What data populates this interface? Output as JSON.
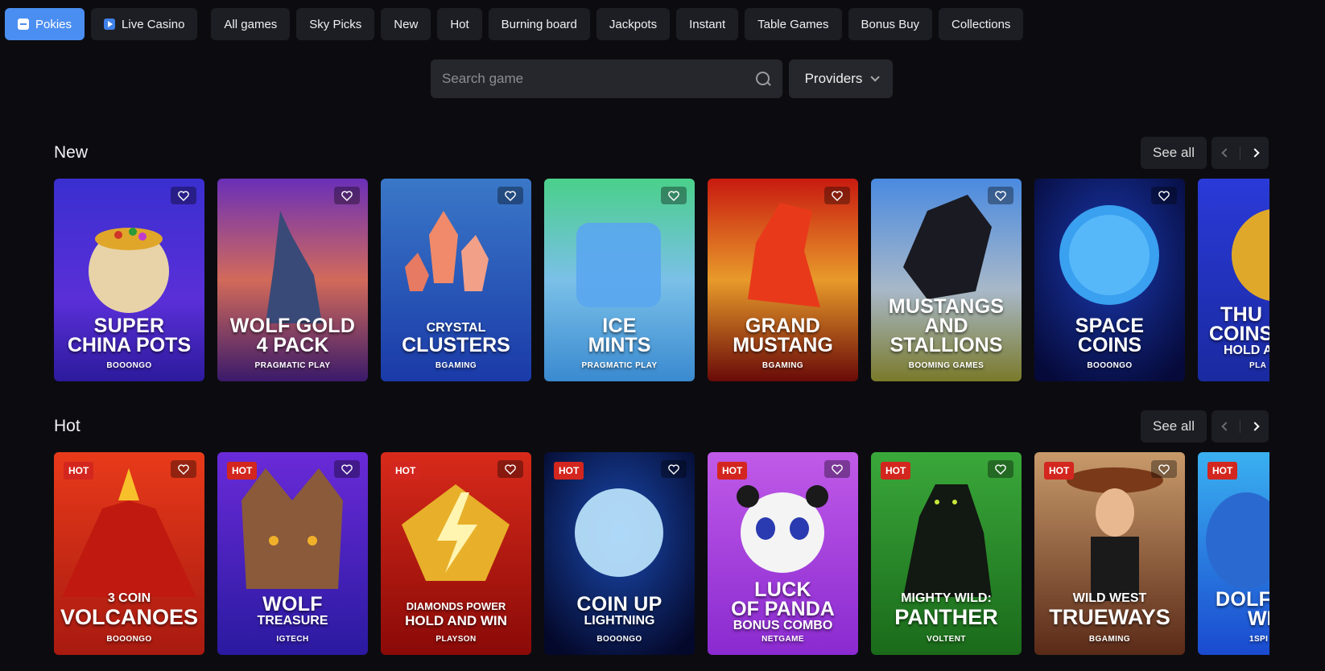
{
  "tabs": {
    "pokies": "Pokies",
    "live": "Live Casino",
    "categories": [
      "All games",
      "Sky Picks",
      "New",
      "Hot",
      "Burning board",
      "Jackpots",
      "Instant",
      "Table Games",
      "Bonus Buy",
      "Collections"
    ]
  },
  "search": {
    "placeholder": "Search game"
  },
  "providers": {
    "label": "Providers"
  },
  "sections": {
    "new": {
      "title": "New",
      "see_all": "See all",
      "games": [
        {
          "l1": "SUPER",
          "l2": "CHINA POTS",
          "provider": "BOOONGO"
        },
        {
          "l1": "WOLF GOLD",
          "l2": "4 PACK",
          "provider": "PRAGMATIC PLAY"
        },
        {
          "l1": "CRYSTAL",
          "l2": "CLUSTERS",
          "provider": "BGAMING"
        },
        {
          "l1": "ICE",
          "l2": "MINTS",
          "provider": "PRAGMATIC PLAY"
        },
        {
          "l1": "GRAND",
          "l2": "MUSTANG",
          "provider": "BGAMING"
        },
        {
          "l1": "MUSTANGS",
          "l2": "AND",
          "l3": "STALLIONS",
          "provider": "BOOMING GAMES"
        },
        {
          "l1": "SPACE",
          "l2": "COINS",
          "provider": "BOOONGO"
        },
        {
          "l1": "THU",
          "l2": "COINS",
          "l3": "HOLD A",
          "provider": "PLA"
        }
      ]
    },
    "hot": {
      "title": "Hot",
      "see_all": "See all",
      "badge": "HOT",
      "games": [
        {
          "l1": "3 COIN",
          "l2": "VOLCANOES",
          "provider": "BOOONGO"
        },
        {
          "l1": "WOLF",
          "l2": "TREASURE",
          "provider": "IGTECH"
        },
        {
          "l1": "DIAMONDS POWER",
          "l2": "HOLD AND WIN",
          "provider": "PLAYSON"
        },
        {
          "l1": "COIN UP",
          "l2": "LIGHTNING",
          "provider": "BOOONGO"
        },
        {
          "l1": "LUCK",
          "l2": "OF PANDA",
          "l3": "BONUS COMBO",
          "provider": "NETGAME"
        },
        {
          "l1": "MIGHTY WILD:",
          "l2": "PANTHER",
          "provider": "VOLTENT"
        },
        {
          "l1": "WILD WEST",
          "l2": "TRUEWAYS",
          "provider": "BGAMING"
        },
        {
          "l1": "DOLF",
          "l2": "WEA",
          "provider": "1SPI"
        }
      ]
    }
  },
  "colors": {
    "accent": "#4b8ef1",
    "hot_badge": "#d3261e",
    "background": "#0c0c10"
  }
}
